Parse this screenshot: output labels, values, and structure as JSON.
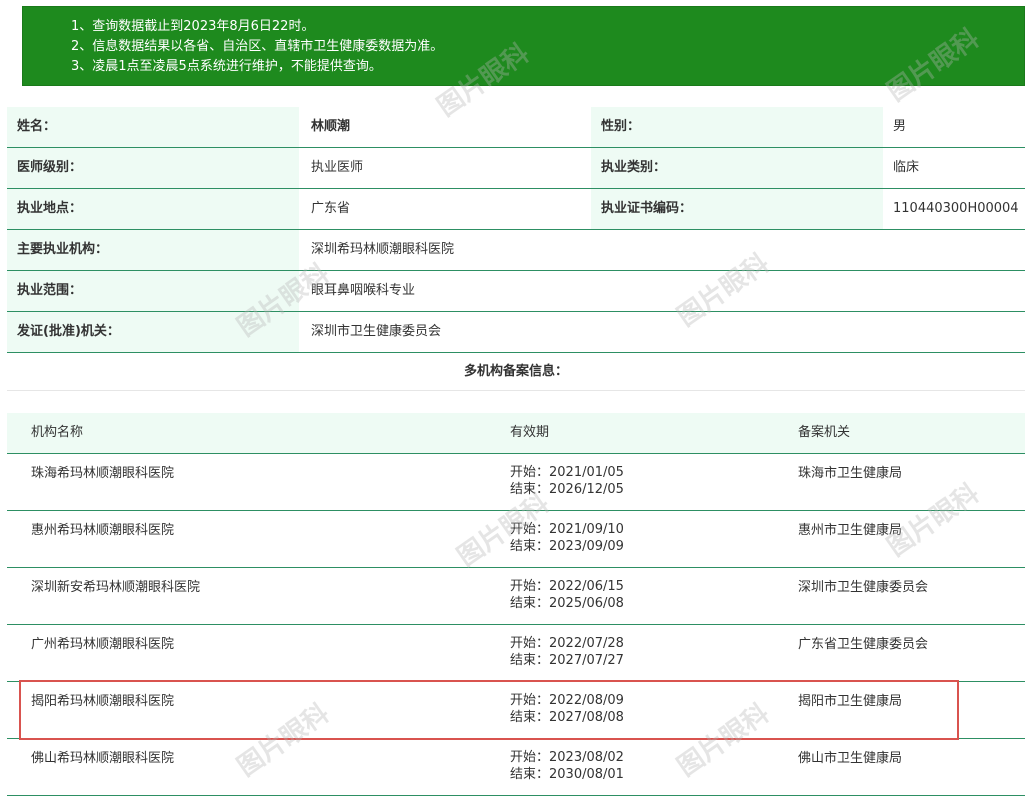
{
  "notice": {
    "lines": [
      "1、查询数据截止到2023年8月6日22时。",
      "2、信息数据结果以各省、自治区、直辖市卫生健康委数据为准。",
      "3、凌晨1点至凌晨5点系统进行维护，不能提供查询。"
    ]
  },
  "info": {
    "name_label": "姓名：",
    "name_value": "林顺潮",
    "gender_label": "性别：",
    "gender_value": "男",
    "level_label": "医师级别：",
    "level_value": "执业医师",
    "category_label": "执业类别：",
    "category_value": "临床",
    "location_label": "执业地点：",
    "location_value": "广东省",
    "cert_label": "执业证书编码：",
    "cert_value": "110440300H00004",
    "org_label": "主要执业机构：",
    "org_value": "深圳希玛林顺潮眼科医院",
    "scope_label": "执业范围：",
    "scope_value": "眼耳鼻咽喉科专业",
    "issuer_label": "发证(批准)机关：",
    "issuer_value": "深圳市卫生健康委员会"
  },
  "multi": {
    "title": "多机构备案信息：",
    "headers": [
      "机构名称",
      "有效期",
      "备案机关"
    ],
    "rows": [
      {
        "org": "珠海希玛林顺潮眼科医院",
        "start": "开始：2021/01/05",
        "end": "结束：2026/12/05",
        "authority": "珠海市卫生健康局"
      },
      {
        "org": "惠州希玛林顺潮眼科医院",
        "start": "开始：2021/09/10",
        "end": "结束：2023/09/09",
        "authority": "惠州市卫生健康局"
      },
      {
        "org": "深圳新安希玛林顺潮眼科医院",
        "start": "开始：2022/06/15",
        "end": "结束：2025/06/08",
        "authority": "深圳市卫生健康委员会"
      },
      {
        "org": "广州希玛林顺潮眼科医院",
        "start": "开始：2022/07/28",
        "end": "结束：2027/07/27",
        "authority": "广东省卫生健康委员会"
      },
      {
        "org": "揭阳希玛林顺潮眼科医院",
        "start": "开始：2022/08/09",
        "end": "结束：2027/08/08",
        "authority": "揭阳市卫生健康局"
      },
      {
        "org": "佛山希玛林顺潮眼科医院",
        "start": "开始：2023/08/02",
        "end": "结束：2030/08/01",
        "authority": "佛山市卫生健康局"
      }
    ]
  },
  "watermark": "图片眼科",
  "colors": {
    "notice_bg": "#1e8a1e",
    "label_bg": "#eefbf4",
    "row_border": "#2d8f63",
    "highlight": "#d9534f"
  }
}
